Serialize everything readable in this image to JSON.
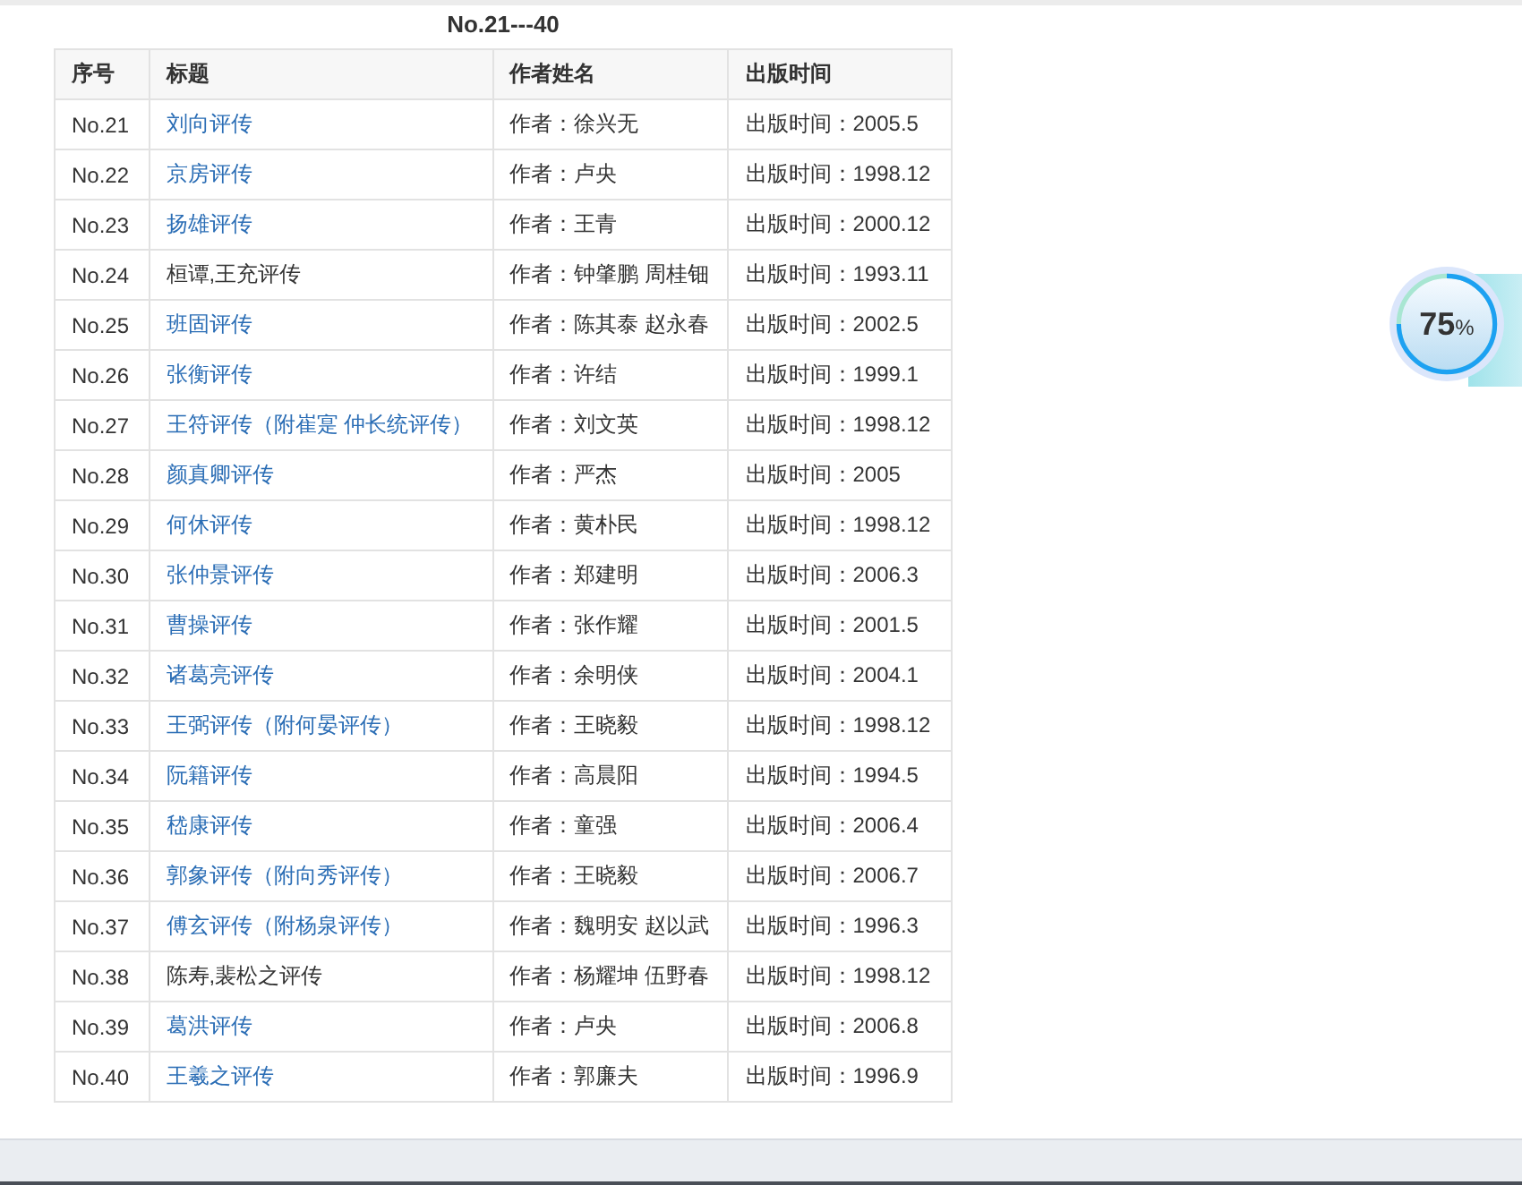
{
  "heading": "No.21---40",
  "table": {
    "columns": [
      "序号",
      "标题",
      "作者姓名",
      "出版时间"
    ],
    "rows": [
      {
        "no": "No.21",
        "title": "刘向评传",
        "link": true,
        "author": "作者：徐兴无",
        "date": "出版时间：2005.5"
      },
      {
        "no": "No.22",
        "title": "京房评传",
        "link": true,
        "author": "作者：卢央",
        "date": "出版时间：1998.12"
      },
      {
        "no": "No.23",
        "title": "扬雄评传",
        "link": true,
        "author": "作者：王青",
        "date": "出版时间：2000.12"
      },
      {
        "no": "No.24",
        "title": "桓谭,王充评传",
        "link": false,
        "author": "作者：钟肇鹏 周桂钿",
        "date": "出版时间：1993.11"
      },
      {
        "no": "No.25",
        "title": "班固评传",
        "link": true,
        "author": "作者：陈其泰 赵永春",
        "date": "出版时间：2002.5"
      },
      {
        "no": "No.26",
        "title": "张衡评传",
        "link": true,
        "author": "作者：许结",
        "date": "出版时间：1999.1"
      },
      {
        "no": "No.27",
        "title": "王符评传（附崔寔 仲长统评传）",
        "link": true,
        "author": "作者：刘文英",
        "date": "出版时间：1998.12"
      },
      {
        "no": "No.28",
        "title": "颜真卿评传",
        "link": true,
        "author": "作者：严杰",
        "date": "出版时间：2005"
      },
      {
        "no": "No.29",
        "title": "何休评传",
        "link": true,
        "author": "作者：黄朴民",
        "date": "出版时间：1998.12"
      },
      {
        "no": "No.30",
        "title": "张仲景评传",
        "link": true,
        "author": "作者：郑建明",
        "date": "出版时间：2006.3"
      },
      {
        "no": "No.31",
        "title": "曹操评传",
        "link": true,
        "author": "作者：张作耀",
        "date": "出版时间：2001.5"
      },
      {
        "no": "No.32",
        "title": "诸葛亮评传",
        "link": true,
        "author": "作者：余明侠",
        "date": "出版时间：2004.1"
      },
      {
        "no": "No.33",
        "title": "王弼评传（附何晏评传）",
        "link": true,
        "author": "作者：王晓毅",
        "date": "出版时间：1998.12"
      },
      {
        "no": "No.34",
        "title": "阮籍评传",
        "link": true,
        "author": "作者：高晨阳",
        "date": "出版时间：1994.5"
      },
      {
        "no": "No.35",
        "title": "嵇康评传",
        "link": true,
        "author": "作者：童强",
        "date": "出版时间：2006.4"
      },
      {
        "no": "No.36",
        "title": "郭象评传（附向秀评传）",
        "link": true,
        "author": "作者：王晓毅",
        "date": "出版时间：2006.7"
      },
      {
        "no": "No.37",
        "title": "傅玄评传（附杨泉评传）",
        "link": true,
        "author": "作者：魏明安 赵以武",
        "date": "出版时间：1996.3"
      },
      {
        "no": "No.38",
        "title": "陈寿,裴松之评传",
        "link": false,
        "author": "作者：杨耀坤 伍野春",
        "date": "出版时间：1998.12"
      },
      {
        "no": "No.39",
        "title": "葛洪评传",
        "link": true,
        "author": "作者：卢央",
        "date": "出版时间：2006.8"
      },
      {
        "no": "No.40",
        "title": "王羲之评传",
        "link": true,
        "author": "作者：郭廉夫",
        "date": "出版时间：1996.9"
      }
    ]
  },
  "gauge": {
    "value": "75",
    "unit": "%"
  }
}
